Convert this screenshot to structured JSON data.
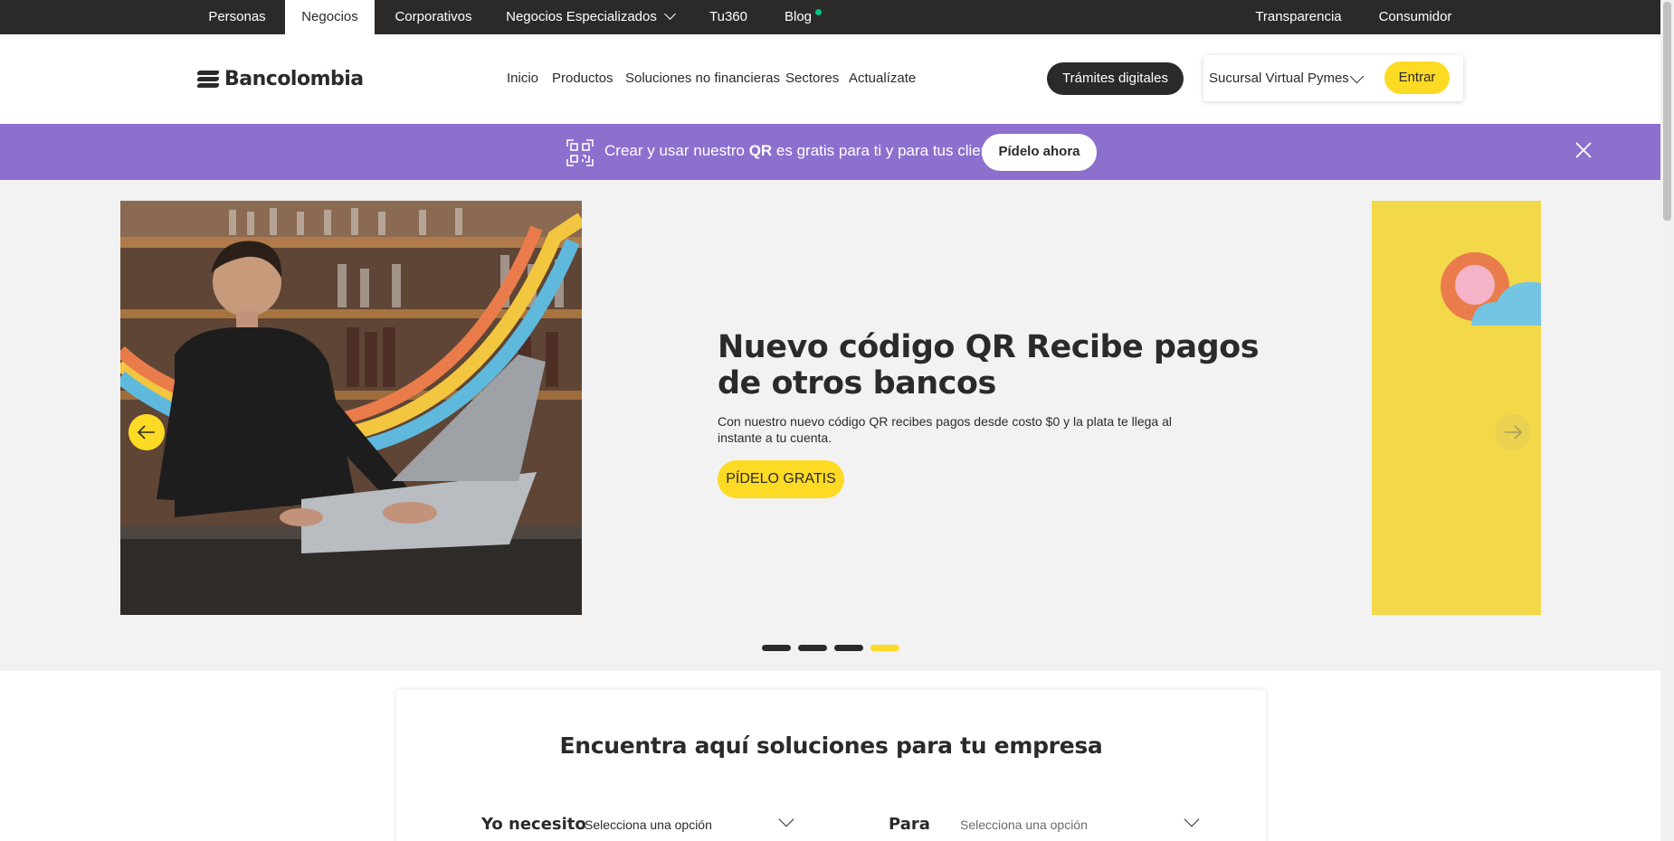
{
  "segments": {
    "personas": "Personas",
    "negocios": "Negocios",
    "corporativos": "Corporativos",
    "especializados": "Negocios Especializados",
    "tu360": "Tu360",
    "blog": "Blog",
    "transparencia": "Transparencia",
    "consumidor": "Consumidor"
  },
  "header": {
    "logo_text": "Bancolombia",
    "nav": {
      "inicio": "Inicio",
      "productos": "Productos",
      "soluciones": "Soluciones no financieras",
      "sectores": "Sectores",
      "actualizate": "Actualízate"
    },
    "tramites_label": "Trámites digitales",
    "login_select": "Sucursal Virtual Pymes",
    "login_button": "Entrar"
  },
  "promo": {
    "text_before": "Crear y usar nuestro ",
    "text_bold": "QR",
    "text_after": " es gratis para ti y para tus clientes.",
    "button": "Pídelo ahora"
  },
  "hero": {
    "title": "Nuevo código QR Recibe pagos de otros bancos",
    "description": "Con nuestro nuevo código QR recibes pagos desde costo $0 y la plata te llega al instante a tu cuenta.",
    "cta": "PÍDELO GRATIS",
    "active_slide": 4,
    "slide_count": 4
  },
  "search_card": {
    "title": "Encuentra aquí soluciones para tu empresa",
    "need_label": "Yo necesito",
    "need_placeholder": "Selecciona una opción",
    "for_label": "Para",
    "for_placeholder": "Selecciona una opción"
  },
  "colors": {
    "brand_dark": "#2c2a29",
    "brand_yellow": "#fdda24",
    "promo_purple": "#8d6fcd",
    "hero_bg": "#f2f2f2"
  },
  "icons": {
    "banner_qr": "qr-code-icon",
    "banner_close": "close-icon",
    "slider_prev": "arrow-left-icon",
    "slider_next": "arrow-right-icon"
  }
}
